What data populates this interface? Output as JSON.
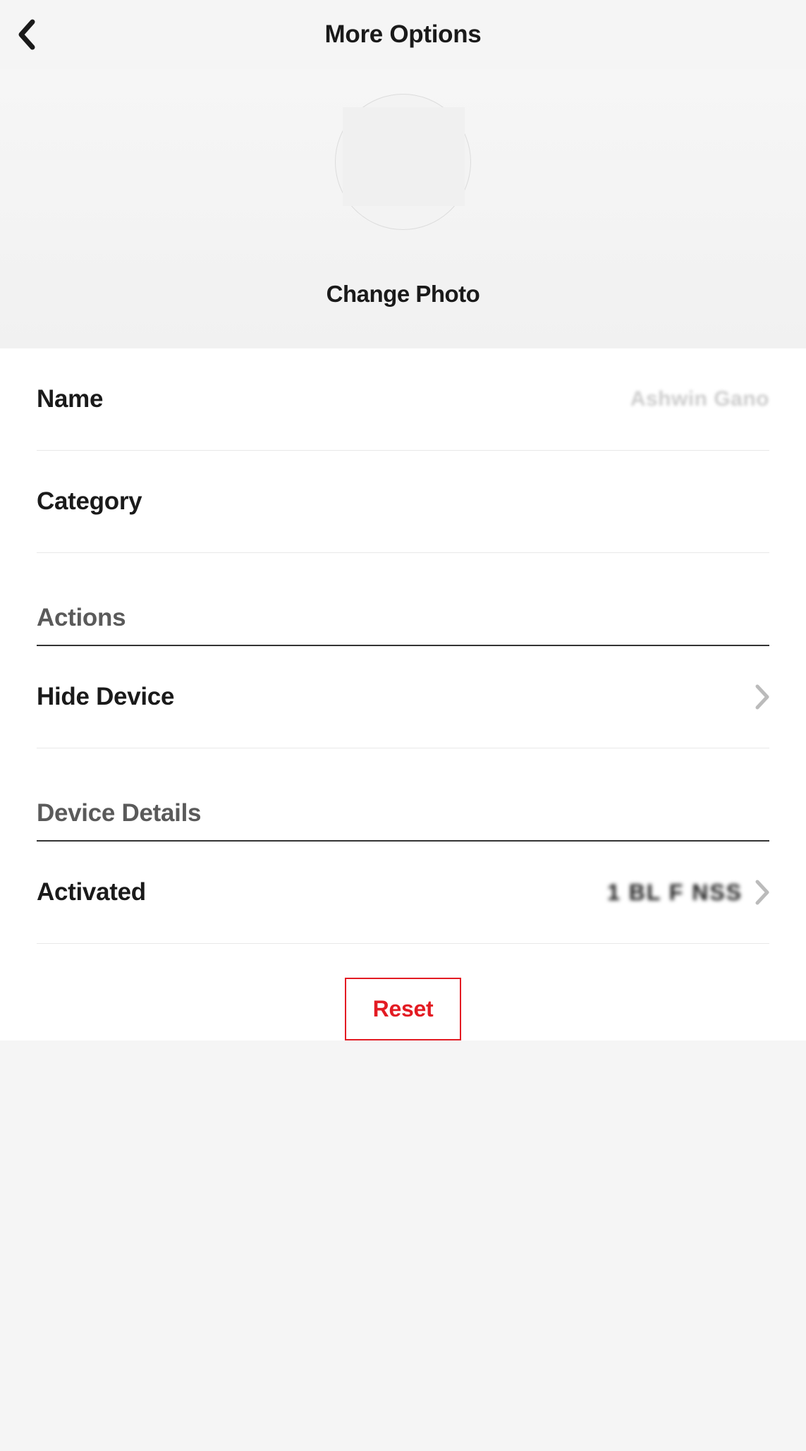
{
  "header": {
    "title": "More Options"
  },
  "photo": {
    "change_label": "Change Photo"
  },
  "fields": {
    "name": {
      "label": "Name",
      "value": "Ashwin Gano"
    },
    "category": {
      "label": "Category",
      "value": ""
    }
  },
  "sections": {
    "actions": {
      "header": "Actions",
      "hide_device": {
        "label": "Hide Device"
      }
    },
    "device_details": {
      "header": "Device Details",
      "activated": {
        "label": "Activated",
        "value": "1 BL F  NSS"
      }
    }
  },
  "reset": {
    "label": "Reset"
  }
}
